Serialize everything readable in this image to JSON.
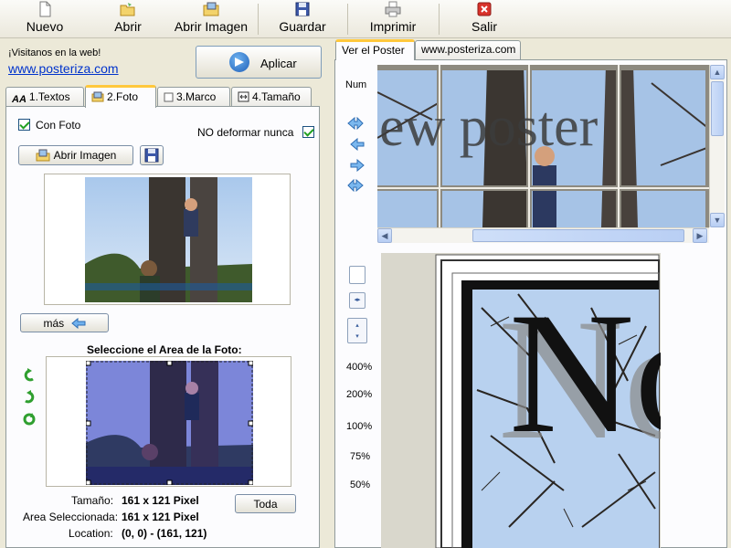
{
  "toolbar": {
    "nuevo": "Nuevo",
    "abrir": "Abrir",
    "abrir_imagen": "Abrir Imagen",
    "guardar": "Guardar",
    "imprimir": "Imprimir",
    "salir": "Salir"
  },
  "left": {
    "visit_text": "¡Visitanos en la web!",
    "visit_link": "www.posteriza.com",
    "apply": "Aplicar",
    "tabs": [
      {
        "label": "1.Textos"
      },
      {
        "label": "2.Foto"
      },
      {
        "label": "3.Marco"
      },
      {
        "label": "4.Tamaño"
      }
    ],
    "con_foto": "Con Foto",
    "no_deformar": "NO deformar nunca",
    "abrir_imagen_btn": "Abrir Imagen",
    "mas_btn": "más",
    "select_area_title": "Seleccione el Area de la Foto:",
    "tamano_label": "Tamaño:",
    "tamano_value": "161 x 121 Pixel",
    "area_label": "Area Seleccionada:",
    "area_value": "161 x 121 Pixel",
    "location_label": "Location:",
    "location_value": "(0, 0) - (161, 121)",
    "toda_btn": "Toda"
  },
  "right": {
    "tabs": [
      {
        "label": "Ver el Poster"
      },
      {
        "label": "www.posteriza.com"
      }
    ],
    "num_label": "Num",
    "zoom_levels": [
      "400%",
      "200%",
      "100%",
      "75%",
      "50%"
    ],
    "poster_text_small": "ew poster",
    "poster_text_big": "No"
  },
  "colors": {
    "tab_highlight": "#ffc83c",
    "link": "#0033cc",
    "window_bg": "#ece9d8"
  }
}
